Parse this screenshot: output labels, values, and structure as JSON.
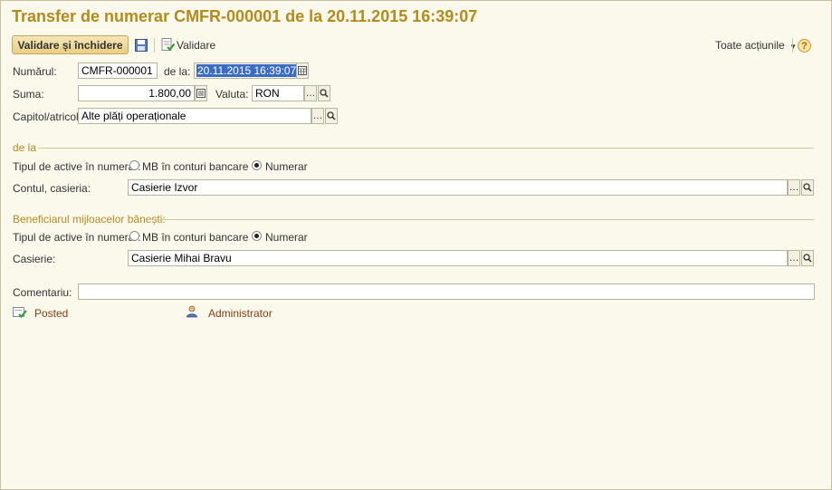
{
  "window": {
    "title": "Transfer de numerar CMFR-000001 de la 20.11.2015 16:39:07"
  },
  "toolbar": {
    "validate_close_label": "Validare și închidere",
    "validate_label": "Validare",
    "all_actions_label": "Toate acțiunile",
    "help_label": "?"
  },
  "header": {
    "number_label": "Numărul:",
    "number_value": "CMFR-000001",
    "date_label": "de la:",
    "date_value": "20.11.2015 16:39:07",
    "sum_label": "Suma:",
    "sum_value": "1.800,00",
    "currency_label": "Valuta:",
    "currency_value": "RON",
    "chapter_label": "Capitol/atricol:",
    "chapter_value": "Alte plăți operaționale"
  },
  "from_section": {
    "title": "de la",
    "asset_type_label": "Tipul de active în numerar:",
    "option_bank": "MB în conturi bancare",
    "option_cash": "Numerar",
    "selected": "cash",
    "account_label": "Contul, casieria:",
    "account_value": "Casierie Izvor"
  },
  "to_section": {
    "title": "Beneficiarul mijloacelor bănești:",
    "asset_type_label": "Tipul de active în numerar:",
    "option_bank": "MB în conturi bancare",
    "option_cash": "Numerar",
    "selected": "cash",
    "cashier_label": "Casierie:",
    "cashier_value": "Casierie Mihai Bravu"
  },
  "comment": {
    "label": "Comentariu:",
    "value": ""
  },
  "footer": {
    "status": "Posted",
    "author": "Administrator"
  },
  "colors": {
    "title": "#b38b1d",
    "background": "#fbf9ec",
    "link": "#8b3a1a",
    "primary_button": "#e8cf86"
  }
}
